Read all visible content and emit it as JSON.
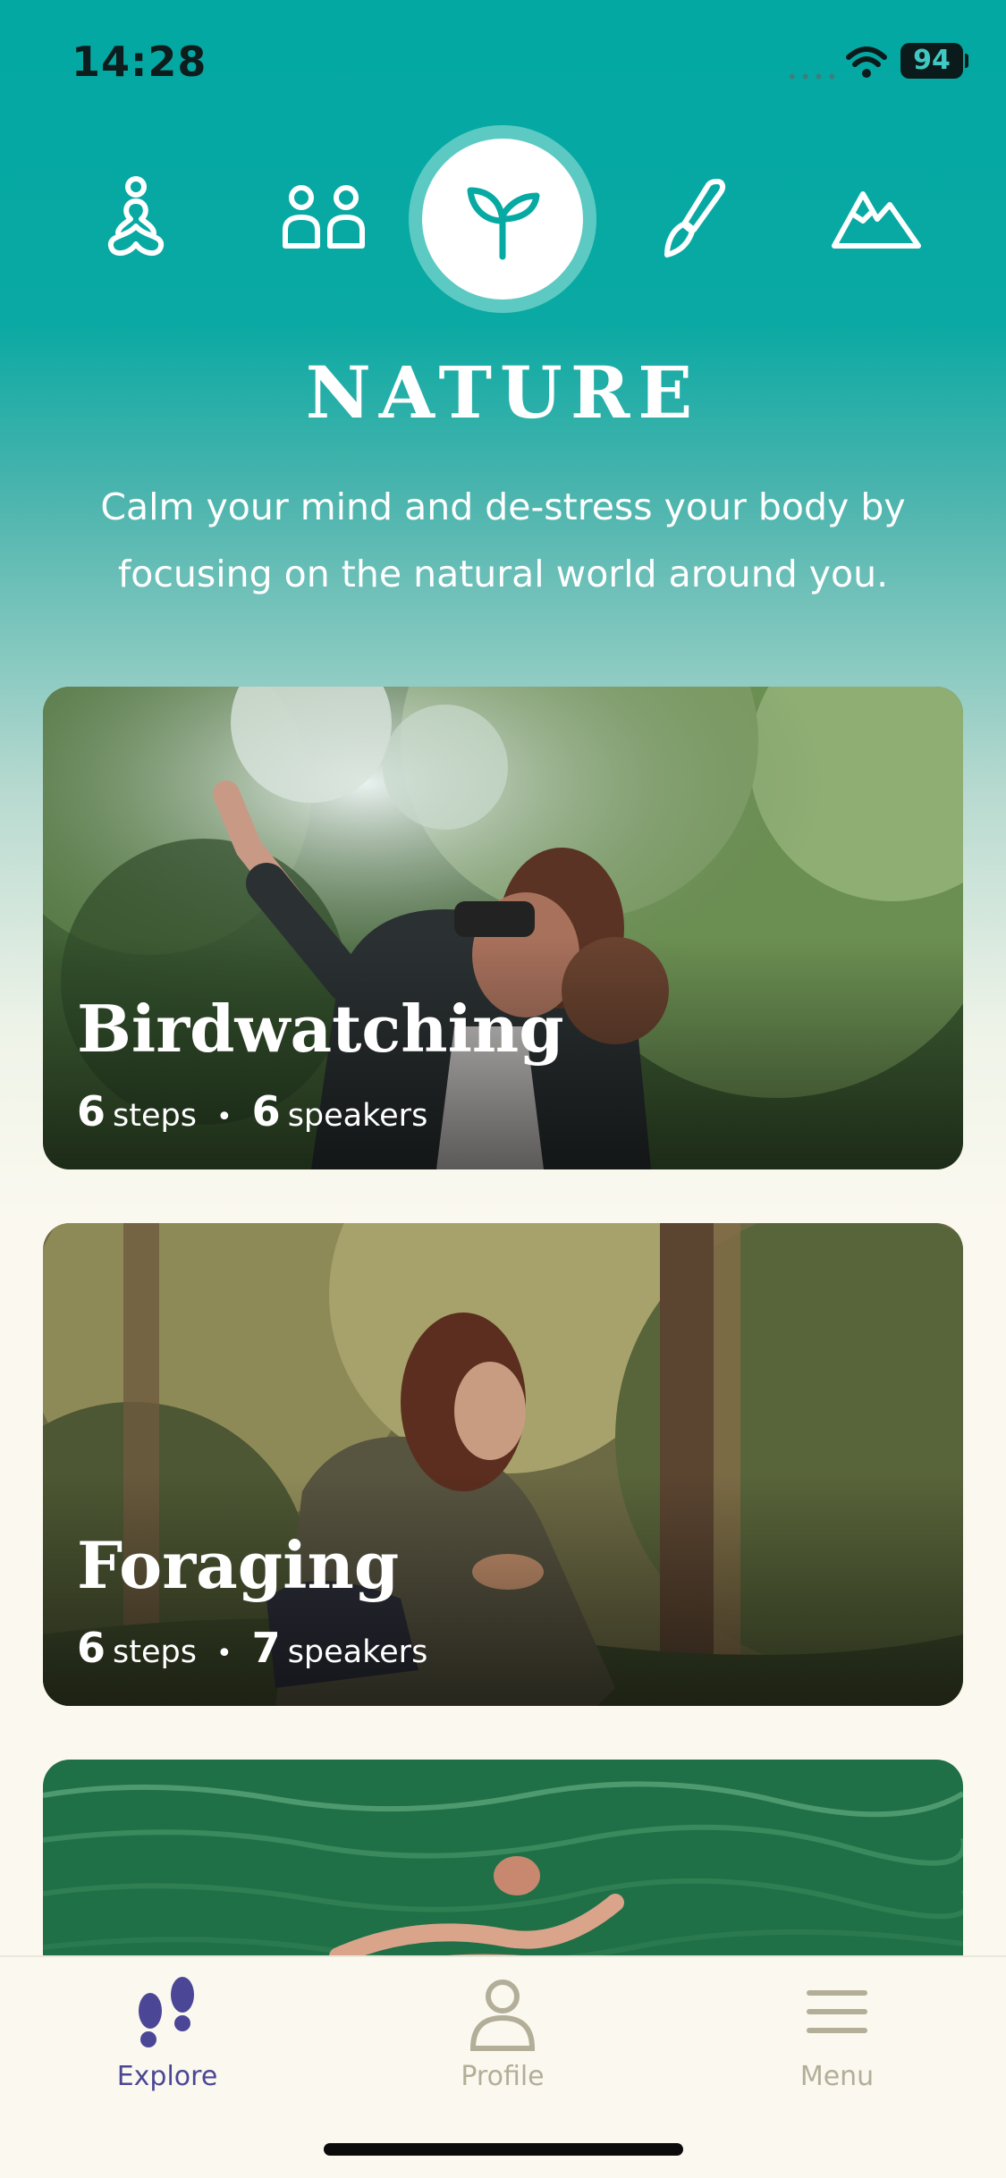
{
  "status_bar": {
    "time": "14:28",
    "battery": "94",
    "signal_dots": "••••"
  },
  "categories": [
    {
      "name": "meditation",
      "icon": "meditation-figure-icon",
      "active": false
    },
    {
      "name": "people",
      "icon": "two-people-icon",
      "active": false
    },
    {
      "name": "nature",
      "icon": "sprout-icon",
      "active": true
    },
    {
      "name": "creativity",
      "icon": "paintbrush-icon",
      "active": false
    },
    {
      "name": "adventure",
      "icon": "mountain-icon",
      "active": false
    }
  ],
  "page": {
    "title": "NATURE",
    "subtitle": "Calm your mind and de-stress your body by focusing on the natural world around you."
  },
  "cards": [
    {
      "title": "Birdwatching",
      "steps": "6",
      "steps_label": "steps",
      "speakers": "6",
      "speakers_label": "speakers"
    },
    {
      "title": "Foraging",
      "steps": "6",
      "steps_label": "steps",
      "speakers": "7",
      "speakers_label": "speakers"
    }
  ],
  "tabbar": {
    "explore": "Explore",
    "profile": "Profile",
    "menu": "Menu"
  },
  "colors": {
    "accent": "#05a8a3",
    "tab_active": "#4b4796",
    "tab_inactive": "#b3ae98"
  }
}
